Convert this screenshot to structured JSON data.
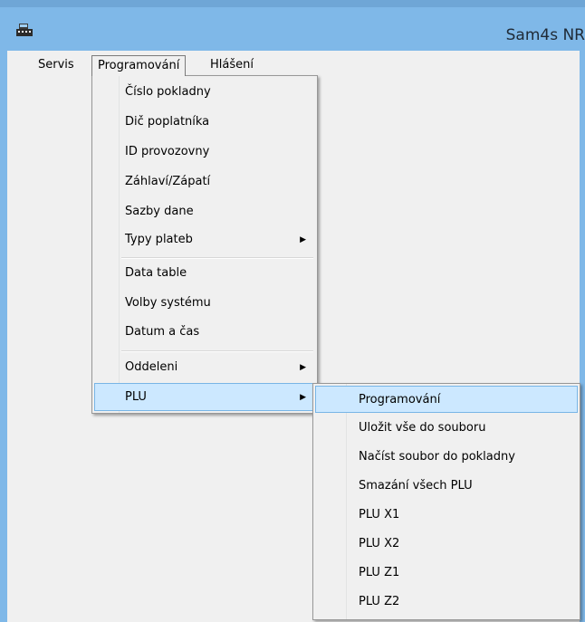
{
  "window": {
    "title": "Sam4s NR"
  },
  "menubar": [
    {
      "label": "Servis"
    },
    {
      "label": "Programování"
    },
    {
      "label": "Hlášení"
    }
  ],
  "programovani_menu": {
    "items": [
      {
        "label": "Číslo pokladny"
      },
      {
        "label": "Dič poplatníka"
      },
      {
        "label": "ID provozovny"
      },
      {
        "label": "Záhlaví/Zápatí"
      },
      {
        "label": "Sazby dane"
      },
      {
        "label": "Typy plateb",
        "submenu": true
      },
      {
        "label": "Data table"
      },
      {
        "label": "Volby systému"
      },
      {
        "label": "Datum a čas"
      },
      {
        "label": "Oddeleni",
        "submenu": true
      },
      {
        "label": "PLU",
        "submenu": true,
        "highlighted": true
      }
    ]
  },
  "plu_submenu": {
    "items": [
      {
        "label": "Programování",
        "highlighted": true
      },
      {
        "label": "Uložit vše do souboru"
      },
      {
        "label": "Načíst soubor do pokladny"
      },
      {
        "label": "Smazání všech PLU"
      },
      {
        "label": "PLU X1"
      },
      {
        "label": "PLU X2"
      },
      {
        "label": "PLU Z1"
      },
      {
        "label": "PLU Z2"
      }
    ]
  },
  "icons": {
    "submenu_arrow": "▶",
    "app": "cash-register-icon"
  },
  "colors": {
    "titlebar": "#7fb8e8",
    "highlight_bg": "#cce8ff",
    "highlight_border": "#78b5e6"
  }
}
